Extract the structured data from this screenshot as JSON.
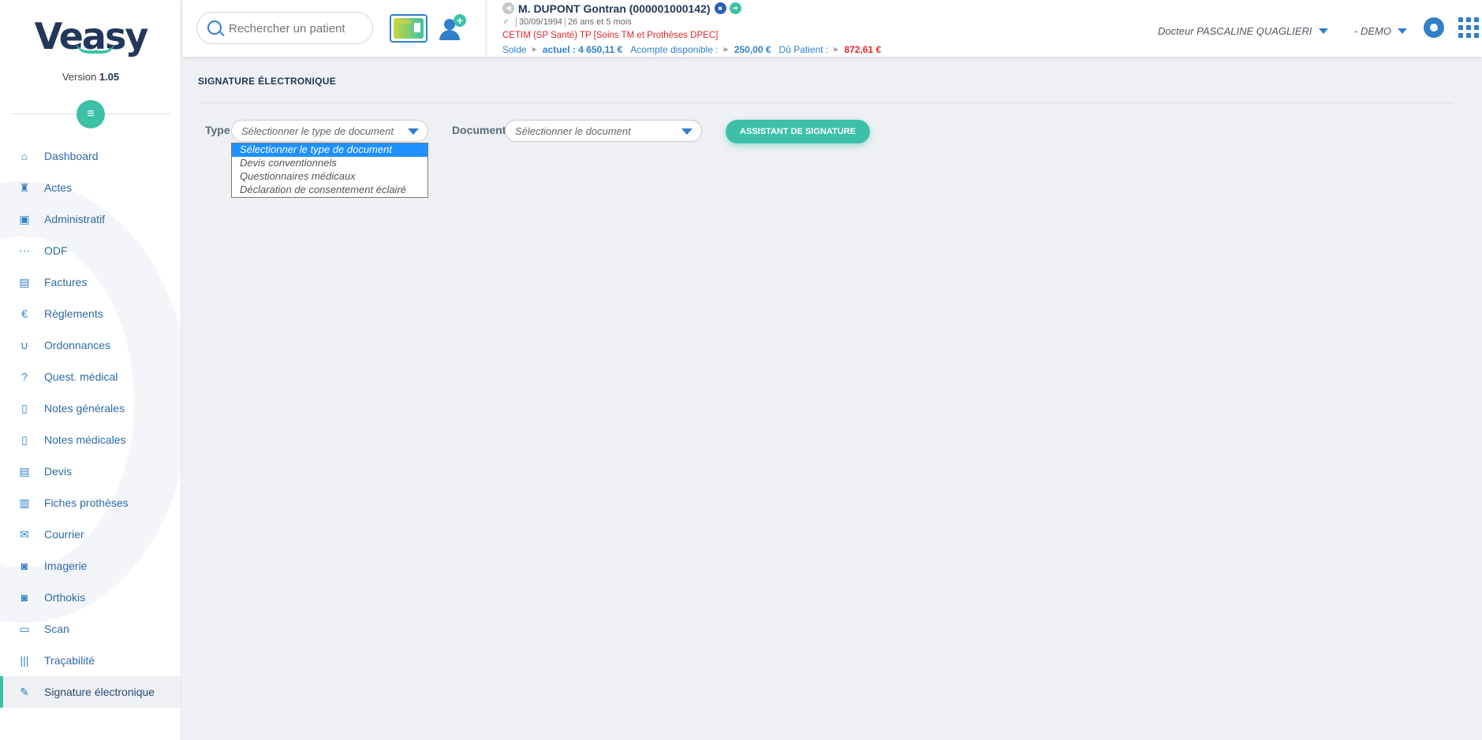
{
  "app": {
    "logo_text": "Veasy",
    "version_label": "Version",
    "version_number": "1.05"
  },
  "sidebar": {
    "items": [
      {
        "label": "Dashboard",
        "icon": "home-icon"
      },
      {
        "label": "Actes",
        "icon": "tooth-icon"
      },
      {
        "label": "Administratif",
        "icon": "id-card-icon"
      },
      {
        "label": "ODF",
        "icon": "braces-icon"
      },
      {
        "label": "Factures",
        "icon": "invoice-icon"
      },
      {
        "label": "Règlements",
        "icon": "euro-icon"
      },
      {
        "label": "Ordonnances",
        "icon": "stethoscope-icon"
      },
      {
        "label": "Quest. médical",
        "icon": "question-icon"
      },
      {
        "label": "Notes générales",
        "icon": "document-icon"
      },
      {
        "label": "Notes médicales",
        "icon": "document-icon"
      },
      {
        "label": "Devis",
        "icon": "quote-icon"
      },
      {
        "label": "Fiches prothèses",
        "icon": "prosthesis-icon"
      },
      {
        "label": "Courrier",
        "icon": "envelope-icon"
      },
      {
        "label": "Imagerie",
        "icon": "camera-icon"
      },
      {
        "label": "Orthokis",
        "icon": "camera-icon"
      },
      {
        "label": "Scan",
        "icon": "inbox-icon"
      },
      {
        "label": "Traçabilité",
        "icon": "barcode-icon"
      },
      {
        "label": "Signature électronique",
        "icon": "edit-icon",
        "active": true
      }
    ]
  },
  "header": {
    "search_placeholder": "Rechercher un patient",
    "vitale_label": "Vitale",
    "patient": {
      "name": "M. DUPONT Gontran (000001000142)",
      "birthdate": "30/09/1994",
      "age": "26 ans et 5 mois",
      "insurance": "CETIM (SP Santé) TP [Soins TM et Prothèses DPEC]",
      "solde_label": "Solde",
      "actuel_value": "actuel : 4 650,11 €",
      "acompte_label": "Acompte disponible :",
      "acompte_value": "250,00 €",
      "du_label": "Dû Patient :",
      "du_value": "872,61 €"
    },
    "doctor": "Docteur PASCALINE QUAGLIERI",
    "center": "- DEMO"
  },
  "main": {
    "title": "SIGNATURE ÉLECTRONIQUE",
    "type_label": "Type",
    "type_select_value": "Sélectionner le type de document",
    "document_label": "Document",
    "document_select_value": "Sélectionner le document",
    "assistant_button": "ASSISTANT DE SIGNATURE",
    "type_options": [
      "Sélectionner le type de document",
      "Devis conventionnels",
      "Questionnaires médicaux",
      "Déclaration de consentement éclairé"
    ]
  },
  "colors": {
    "accent_teal": "#3cc1a8",
    "primary_blue": "#2f80c8",
    "navy": "#23375a",
    "alert_red": "#e0262b"
  }
}
